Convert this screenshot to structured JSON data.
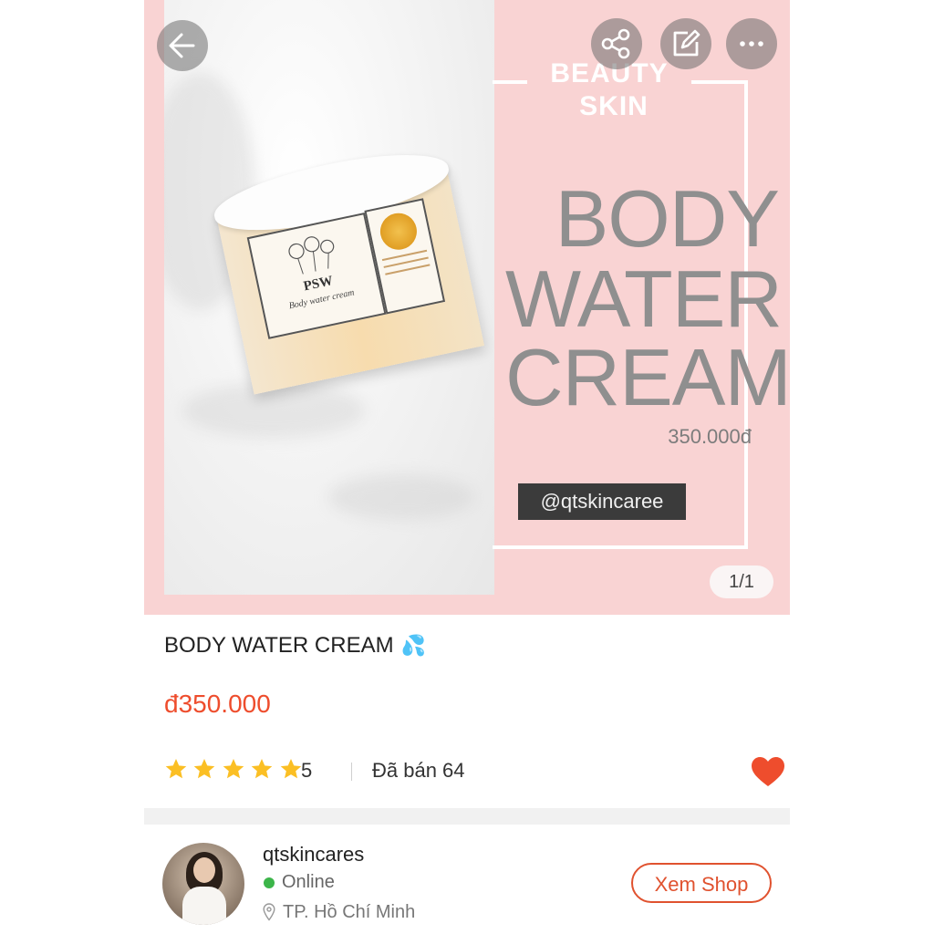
{
  "hero": {
    "beauty": "BEAUTY",
    "skin": "SKIN",
    "line1": "BODY",
    "line2": "WATER",
    "line3": "CREAM",
    "price": "350.000đ",
    "handle": "@qtskincaree",
    "counter": "1/1",
    "jar_brand": "PSW",
    "jar_sub": "Body water cream"
  },
  "product": {
    "title": "BODY WATER CREAM",
    "title_emoji": "💦",
    "price": "đ350.000",
    "rating_value": "5",
    "stars": 5,
    "sold": "Đã bán 64",
    "favorited": true
  },
  "shop": {
    "name": "qtskincares",
    "status": "Online",
    "location": "TP. Hồ Chí Minh",
    "view_button": "Xem Shop"
  },
  "colors": {
    "accent": "#ee4d2d",
    "hero_bg": "#f9d3d3",
    "online": "#3cb54a",
    "star": "#fbbf24"
  },
  "icons": [
    "back-arrow-icon",
    "share-icon",
    "edit-icon",
    "more-icon",
    "star-icon",
    "heart-icon",
    "location-pin-icon"
  ]
}
